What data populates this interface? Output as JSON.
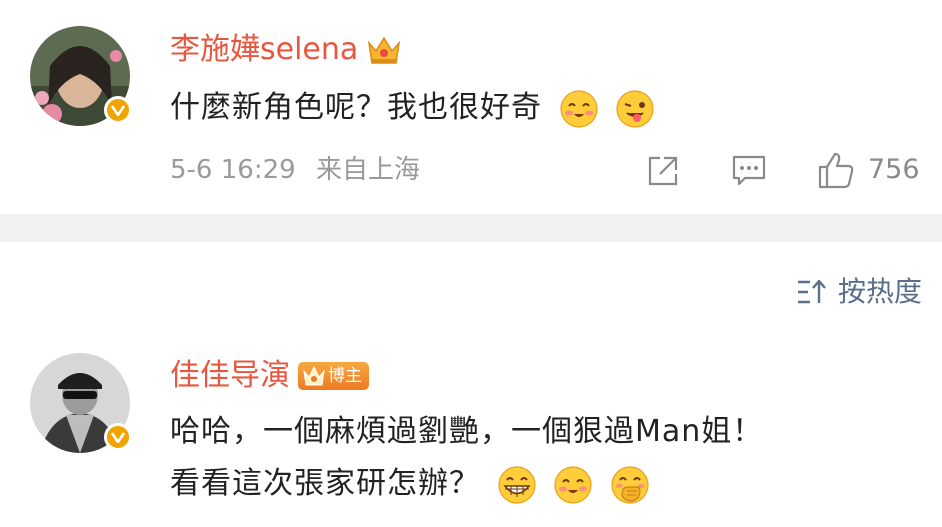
{
  "first_comment": {
    "username": "李施嬅selena",
    "text": "什麼新角色呢？我也很好奇",
    "emojis": [
      "blush-smile-icon",
      "wink-tongue-icon"
    ],
    "time": "5-6 16:29",
    "location": "来自上海",
    "likes": "756"
  },
  "sort": {
    "label": "按热度"
  },
  "second_comment": {
    "username": "佳佳导演",
    "badge": "博主",
    "line1": "哈哈，一個麻煩過劉艷，一個狠過Man姐！",
    "line2": "看看這次張家研怎辦？",
    "emojis": [
      "grin-icon",
      "blush-smile-icon",
      "giggle-hand-icon"
    ]
  },
  "colors": {
    "username": "#e8573f",
    "meta": "#9a9a9a",
    "verify": "#f0a400",
    "sort": "#5a6f8c"
  }
}
